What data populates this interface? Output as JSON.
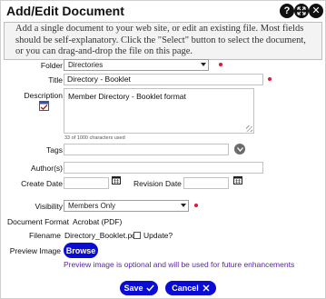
{
  "dialog": {
    "title": "Add/Edit Document",
    "header_icons": [
      "help-icon",
      "expand-icon",
      "close-icon"
    ],
    "info_text": "Add a single document to your web site, or edit an existing file. Most fields should be self-explanatory. Click the \"Select\" button to select the document, or you can drag-and-drop the file on this page."
  },
  "form": {
    "folder": {
      "label": "Folder",
      "value": "Directories"
    },
    "title": {
      "label": "Title",
      "value": "Directory - Booklet"
    },
    "description": {
      "label": "Description",
      "value": "Member Directory - Booklet format",
      "counter": "33 of 1000 characters used"
    },
    "tags": {
      "label": "Tags",
      "value": ""
    },
    "authors": {
      "label": "Author(s)",
      "value": ""
    },
    "create_date": {
      "label": "Create Date",
      "value": ""
    },
    "revision_date": {
      "label": "Revision Date",
      "value": ""
    },
    "visibility": {
      "label": "Visibility",
      "value": "Members Only"
    },
    "document_format": {
      "label": "Document Format",
      "value": "Acrobat (PDF)"
    },
    "filename": {
      "label": "Filename",
      "value": "Directory_Booklet.pdf",
      "update_label": "Update?"
    },
    "preview_image": {
      "label": "Preview Image",
      "browse_label": "Browse",
      "note": "Preview image is optional and will be used for future enhancements"
    }
  },
  "actions": {
    "save_label": "Save",
    "cancel_label": "Cancel"
  },
  "colors": {
    "primary_button": "#0b0bd6",
    "required_marker": "#e0143c",
    "note_text": "#5a1f9e"
  }
}
